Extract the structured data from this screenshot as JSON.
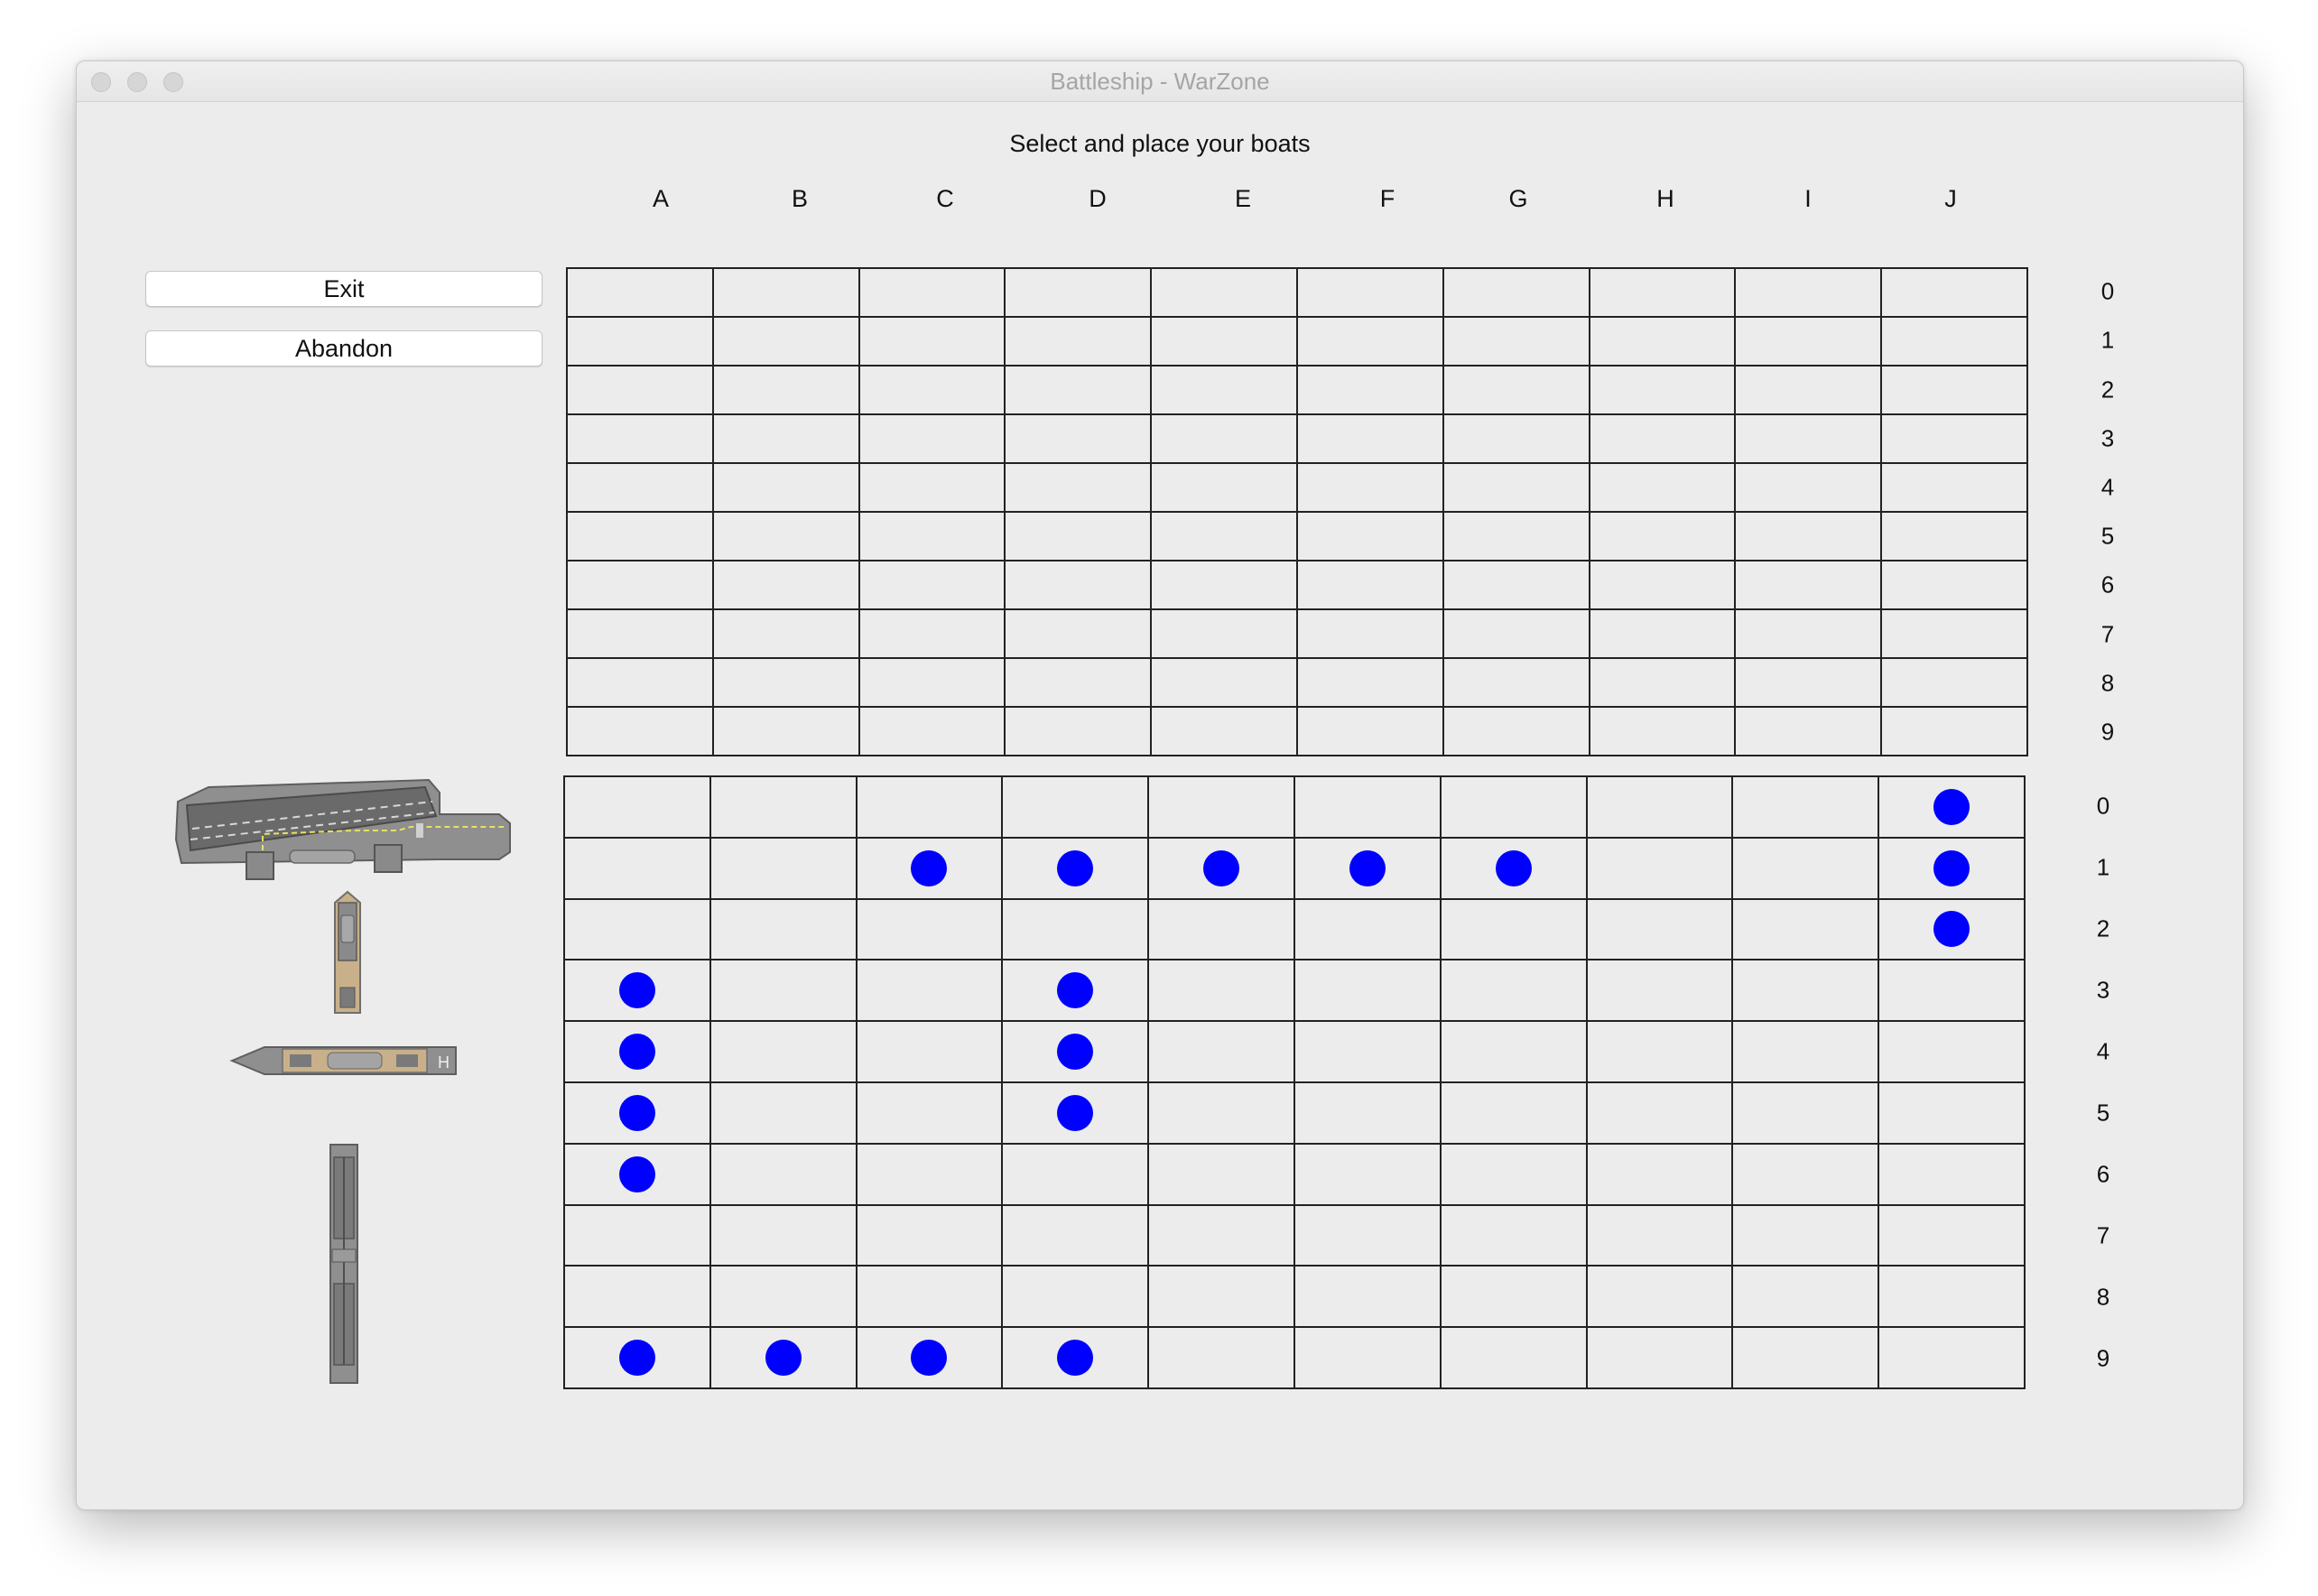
{
  "window": {
    "title": "Battleship - WarZone"
  },
  "heading": "Select and place your boats",
  "columns": [
    "A",
    "B",
    "C",
    "D",
    "E",
    "F",
    "G",
    "H",
    "I",
    "J"
  ],
  "rows": [
    "0",
    "1",
    "2",
    "3",
    "4",
    "5",
    "6",
    "7",
    "8",
    "9"
  ],
  "buttons": {
    "exit": "Exit",
    "abandon": "Abandon"
  },
  "colors": {
    "marker": "#0000ff",
    "grid_line": "#222222",
    "background": "#ececec"
  },
  "ships": [
    {
      "name": "aircraft-carrier",
      "orientation": "horizontal"
    },
    {
      "name": "destroyer",
      "orientation": "vertical"
    },
    {
      "name": "cruiser",
      "orientation": "horizontal"
    },
    {
      "name": "battleship",
      "orientation": "vertical"
    }
  ],
  "placed_markers": [
    [
      "J",
      "0"
    ],
    [
      "C",
      "1"
    ],
    [
      "D",
      "1"
    ],
    [
      "E",
      "1"
    ],
    [
      "F",
      "1"
    ],
    [
      "G",
      "1"
    ],
    [
      "J",
      "1"
    ],
    [
      "J",
      "2"
    ],
    [
      "A",
      "3"
    ],
    [
      "D",
      "3"
    ],
    [
      "A",
      "4"
    ],
    [
      "D",
      "4"
    ],
    [
      "A",
      "5"
    ],
    [
      "D",
      "5"
    ],
    [
      "A",
      "6"
    ],
    [
      "A",
      "9"
    ],
    [
      "B",
      "9"
    ],
    [
      "C",
      "9"
    ],
    [
      "D",
      "9"
    ]
  ]
}
